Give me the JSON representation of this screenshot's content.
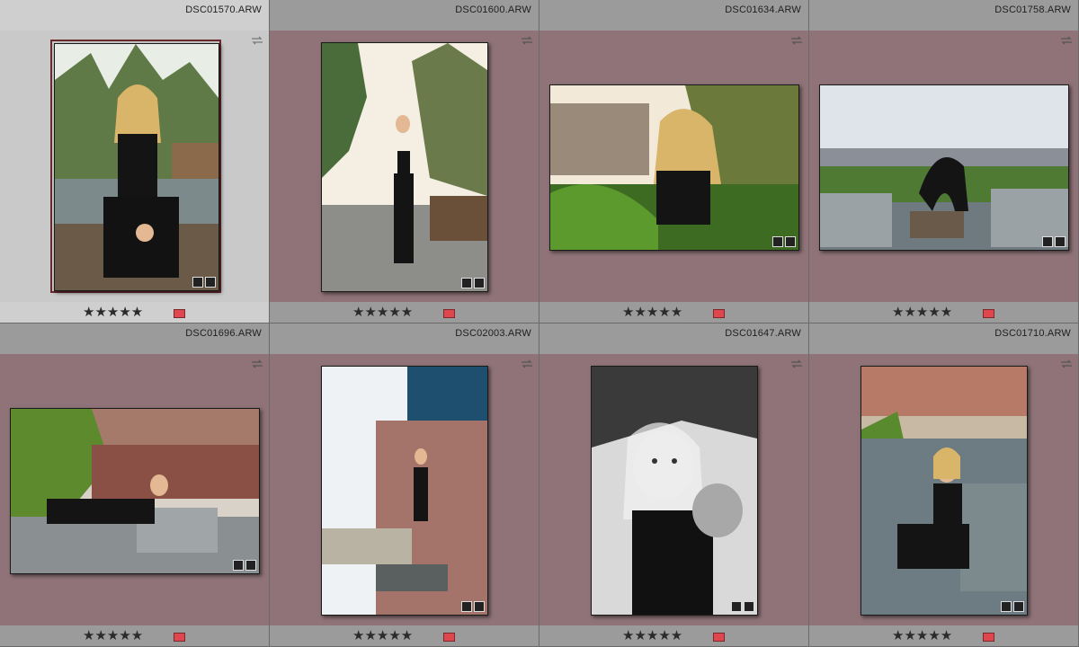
{
  "grid": {
    "cells": [
      {
        "filename": "DSC01570.ARW",
        "rating": "★★★★★",
        "selected": true,
        "color_label": "red"
      },
      {
        "filename": "DSC01600.ARW",
        "rating": "★★★★★",
        "selected": false,
        "color_label": "red"
      },
      {
        "filename": "DSC01634.ARW",
        "rating": "★★★★★",
        "selected": false,
        "color_label": "red"
      },
      {
        "filename": "DSC01758.ARW",
        "rating": "★★★★★",
        "selected": false,
        "color_label": "red"
      },
      {
        "filename": "DSC01696.ARW",
        "rating": "★★★★★",
        "selected": false,
        "color_label": "red"
      },
      {
        "filename": "DSC02003.ARW",
        "rating": "★★★★★",
        "selected": false,
        "color_label": "red"
      },
      {
        "filename": "DSC01647.ARW",
        "rating": "★★★★★",
        "selected": false,
        "color_label": "red"
      },
      {
        "filename": "DSC01710.ARW",
        "rating": "★★★★★",
        "selected": false,
        "color_label": "red"
      }
    ]
  },
  "colors": {
    "cell_background": "#8f7378",
    "selected_background": "#c9c9c9",
    "header_background": "#9b9b9b",
    "red_label": "#e0464d"
  },
  "icons": {
    "sync": "sync-arrows-icon",
    "keyword": "keyword-tag-icon",
    "develop": "develop-adjusted-icon"
  }
}
